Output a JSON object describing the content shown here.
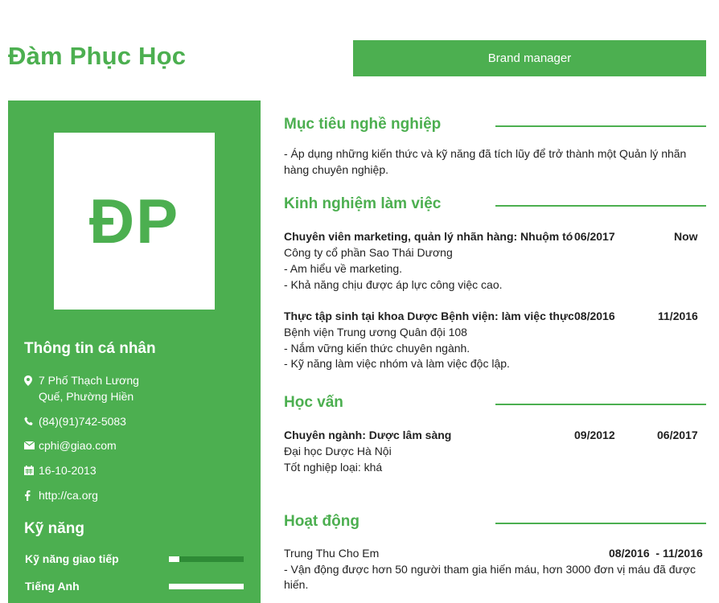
{
  "header": {
    "name": "Đàm Phục Học",
    "position": "Brand manager"
  },
  "sidebar": {
    "avatar_initials": "ĐP",
    "personal_info_heading": "Thông tin cá nhân",
    "contact": {
      "address_line1": "7 Phố Thạch Lương",
      "address_line2": "Quế, Phường Hiền",
      "phone": "(84)(91)742-5083",
      "email": "cphi@giao.com",
      "birthday": "16-10-2013",
      "website": "http://ca.org"
    },
    "icons": {
      "address": "map-marker-icon",
      "phone": "phone-icon",
      "email": "envelope-icon",
      "birthday": "calendar-icon",
      "website": "facebook-icon"
    },
    "skills_heading": "Kỹ năng",
    "skills": [
      {
        "label": "Kỹ năng giao tiếp",
        "level": 0.14
      },
      {
        "label": "Tiếng Anh",
        "level": 1.0
      }
    ]
  },
  "objective": {
    "title": "Mục tiêu nghề nghiệp",
    "line1": "- Áp dụng những kiến thức và kỹ năng đã tích lũy để trở thành một Quản lý nhãn",
    "line2": "hàng chuyên nghiệp."
  },
  "experience": {
    "title": "Kinh nghiệm làm việc",
    "items": [
      {
        "role": "Chuyên viên marketing, quản lý nhãn hàng: Nhuộm tóc",
        "start": "06/2017",
        "end": "Now",
        "company": "Công ty cổ phần Sao Thái Dương",
        "details": [
          "- Am hiểu về marketing.",
          "- Khả năng chịu được áp lực công việc cao."
        ]
      },
      {
        "role": "Thực tập sinh tại khoa Dược Bệnh viện: làm việc thực tế",
        "start": "08/2016",
        "end": "11/2016",
        "company": "Bệnh viện Trung ương Quân đội 108",
        "details": [
          "- Nắm vững kiến thức chuyên ngành.",
          "- Kỹ năng làm việc nhóm và làm việc độc lập."
        ]
      }
    ]
  },
  "education": {
    "title": "Học vấn",
    "major": "Chuyên ngành: Dược lâm sàng",
    "start": "09/2012",
    "end": "06/2017",
    "school": "Đại học Dược Hà Nội",
    "grade": "Tốt nghiệp loại: khá"
  },
  "activities": {
    "title": "Hoạt động",
    "name": "Trung Thu Cho Em",
    "dates": "08/2016  - 11/2016",
    "line1": "- Vận động được hơn 50 người tham gia hiến máu, hơn 3000 đơn vị máu đã được",
    "line2": "hiến."
  },
  "colors": {
    "accent": "#4caf50",
    "skill_track": "#2e8b36",
    "text": "#222222"
  }
}
